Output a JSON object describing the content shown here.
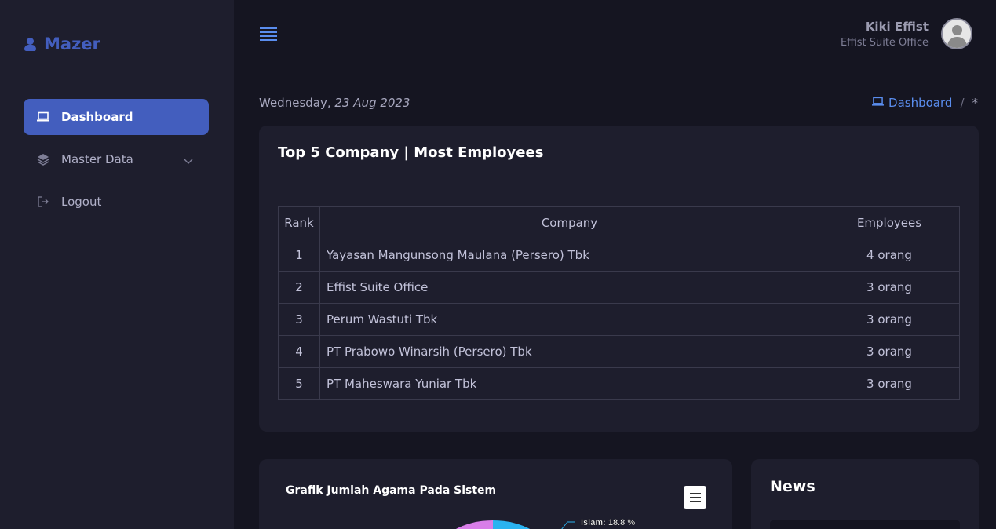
{
  "brand": {
    "name": "Mazer"
  },
  "sidebar": {
    "items": [
      {
        "label": "Dashboard",
        "icon": "laptop-icon",
        "active": true
      },
      {
        "label": "Master Data",
        "icon": "layers-icon",
        "has_submenu": true
      },
      {
        "label": "Logout",
        "icon": "logout-icon"
      }
    ]
  },
  "header": {
    "user_name": "Kiki Effist",
    "user_org": "Effist Suite Office"
  },
  "page": {
    "date_day": "Wednesday,",
    "date_value": "23 Aug 2023",
    "breadcrumb": {
      "link": "Dashboard",
      "separator": "/",
      "current": "*"
    }
  },
  "top_companies": {
    "title": "Top 5 Company | Most Employees",
    "headers": {
      "rank": "Rank",
      "company": "Company",
      "employees": "Employees"
    },
    "rows": [
      {
        "rank": "1",
        "company": "Yayasan Mangunsong Maulana (Persero) Tbk",
        "employees": "4 orang"
      },
      {
        "rank": "2",
        "company": "Effist Suite Office",
        "employees": "3 orang"
      },
      {
        "rank": "3",
        "company": "Perum Wastuti Tbk",
        "employees": "3 orang"
      },
      {
        "rank": "4",
        "company": "PT Prabowo Winarsih (Persero) Tbk",
        "employees": "3 orang"
      },
      {
        "rank": "5",
        "company": "PT Maheswara Yuniar Tbk",
        "employees": "3 orang"
      }
    ]
  },
  "religion_chart": {
    "title": "Grafik Jumlah Agama Pada Sistem",
    "visible_label": "Islam: 18.8 %",
    "colors": {
      "slice_a": "#d87ee8",
      "slice_b": "#2ab3f0"
    }
  },
  "news": {
    "title": "News"
  }
}
